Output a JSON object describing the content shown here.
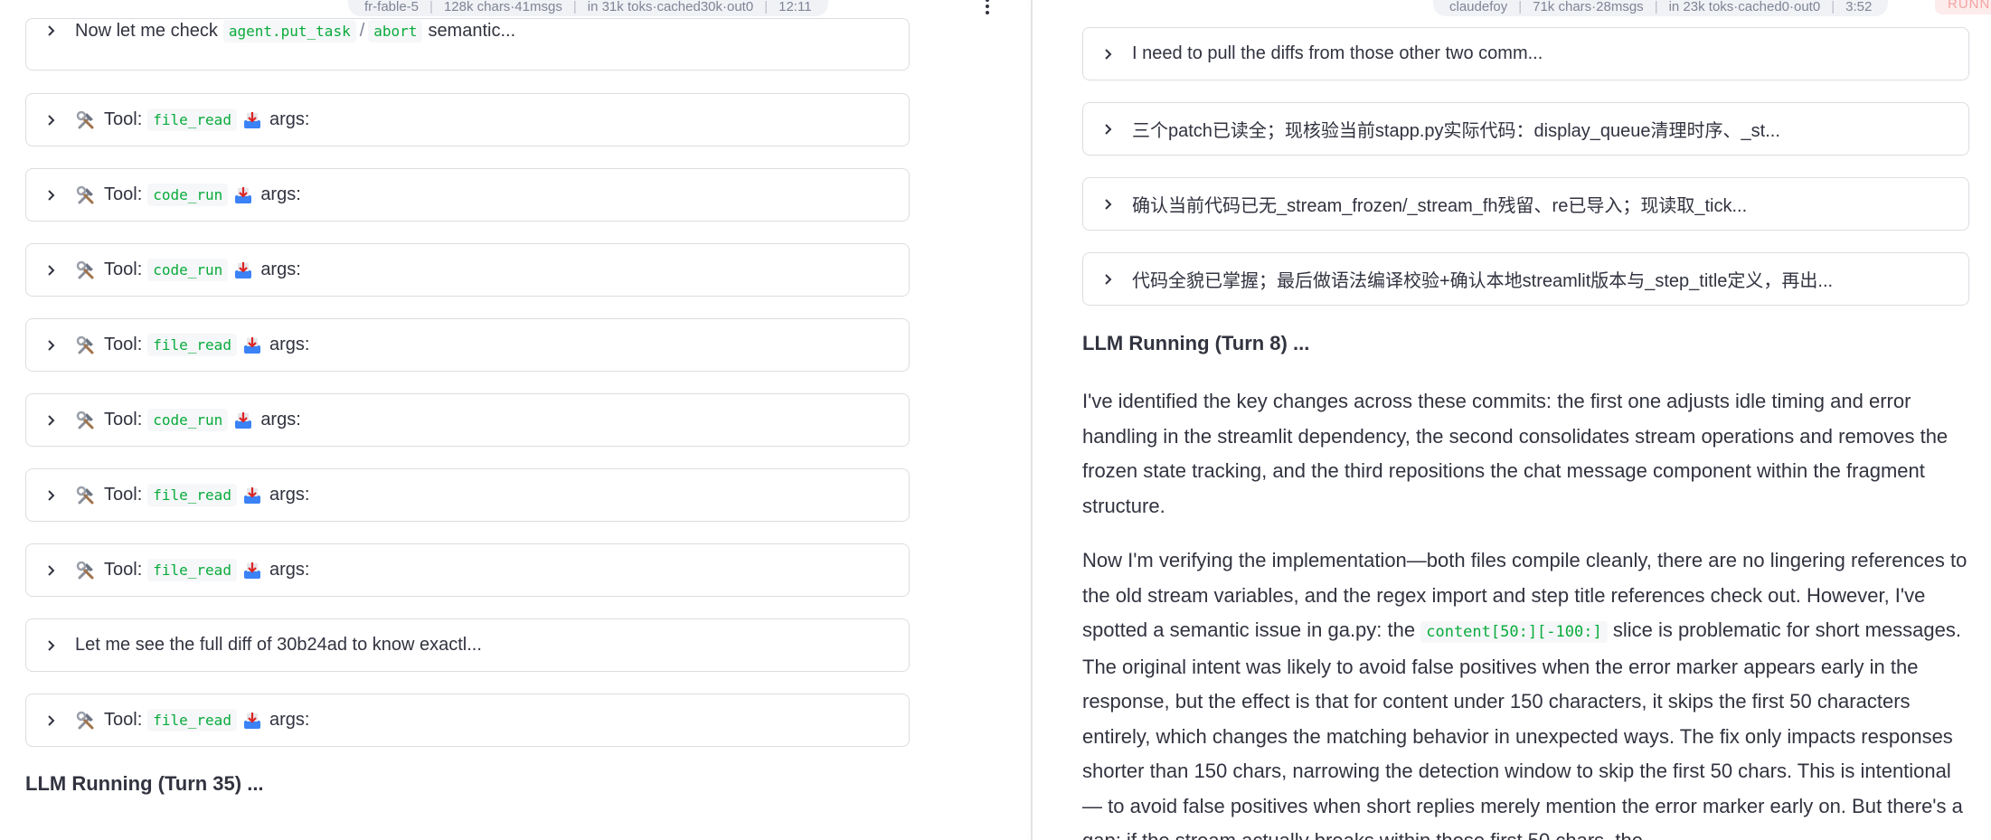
{
  "left": {
    "status": {
      "name": "fr-fable-5",
      "chars_msgs": "128k chars·41msgs",
      "tokens": "in 31k toks·cached30k·out0",
      "time": "12:11"
    },
    "top_item": {
      "prefix": "Now let me check",
      "code1": "agent.put_task",
      "slash": "/",
      "code2": "abort",
      "suffix": "semantic..."
    },
    "tool_items": [
      {
        "label": "Tool:",
        "tool": "file_read",
        "args": "args:"
      },
      {
        "label": "Tool:",
        "tool": "code_run",
        "args": "args:"
      },
      {
        "label": "Tool:",
        "tool": "code_run",
        "args": "args:"
      },
      {
        "label": "Tool:",
        "tool": "file_read",
        "args": "args:"
      },
      {
        "label": "Tool:",
        "tool": "code_run",
        "args": "args:"
      },
      {
        "label": "Tool:",
        "tool": "file_read",
        "args": "args:"
      },
      {
        "label": "Tool:",
        "tool": "file_read",
        "args": "args:"
      }
    ],
    "diff_item": "Let me see the full diff of 30b24ad to know exactl...",
    "last_tool": {
      "label": "Tool:",
      "tool": "file_read",
      "args": "args:"
    },
    "running_heading": "LLM Running (Turn 35) ..."
  },
  "right": {
    "status": {
      "name": "claudefoy",
      "chars_msgs": "71k chars·28msgs",
      "tokens": "in 23k toks·cached0·out0",
      "time": "3:52"
    },
    "run_badge": "RUNN",
    "items": [
      "I need to pull the diffs from those other two comm...",
      "三个patch已读全；现核验当前stapp.py实际代码：display_queue清理时序、_st...",
      "确认当前代码已无_stream_frozen/_stream_fh残留、re已导入；现读取_tick...",
      "代码全貌已掌握；最后做语法编译校验+确认本地streamlit版本与_step_title定义，再出..."
    ],
    "running_heading": "LLM Running (Turn 8) ...",
    "paragraph1": "I've identified the key changes across these commits: the first one adjusts idle timing and error handling in the streamlit dependency, the second consolidates stream operations and removes the frozen state tracking, and the third repositions the chat message component within the fragment structure.",
    "paragraph2_before": "Now I'm verifying the implementation—both files compile cleanly, there are no lingering references to the old stream variables, and the regex import and step title references check out. However, I've spotted a semantic issue in ga.py: the",
    "paragraph2_code": "content[50:][-100:]",
    "paragraph2_after": "slice is problematic for short messages. The original intent was likely to avoid false positives when the error marker appears early in the response, but the effect is that for content under 150 characters, it skips the first 50 characters entirely, which changes the matching behavior in unexpected ways. The fix only impacts responses shorter than 150 chars, narrowing the detection window to skip the first 50 chars. This is intentional — to avoid false positives when short replies merely mention the error marker early on. But there's a gap: if the stream actually breaks within those first 50 chars, the"
  },
  "icons": {
    "tool": "hammer-and-wrench-icon",
    "args": "inbox-tray-icon",
    "expand": "chevron-right-icon",
    "menu": "more-vertical-icon"
  },
  "colors": {
    "code_text": "#09ab3b",
    "pill_bg": "#f0f2f6",
    "border": "#dcdde2",
    "run_badge_text": "#f4a3a3"
  }
}
